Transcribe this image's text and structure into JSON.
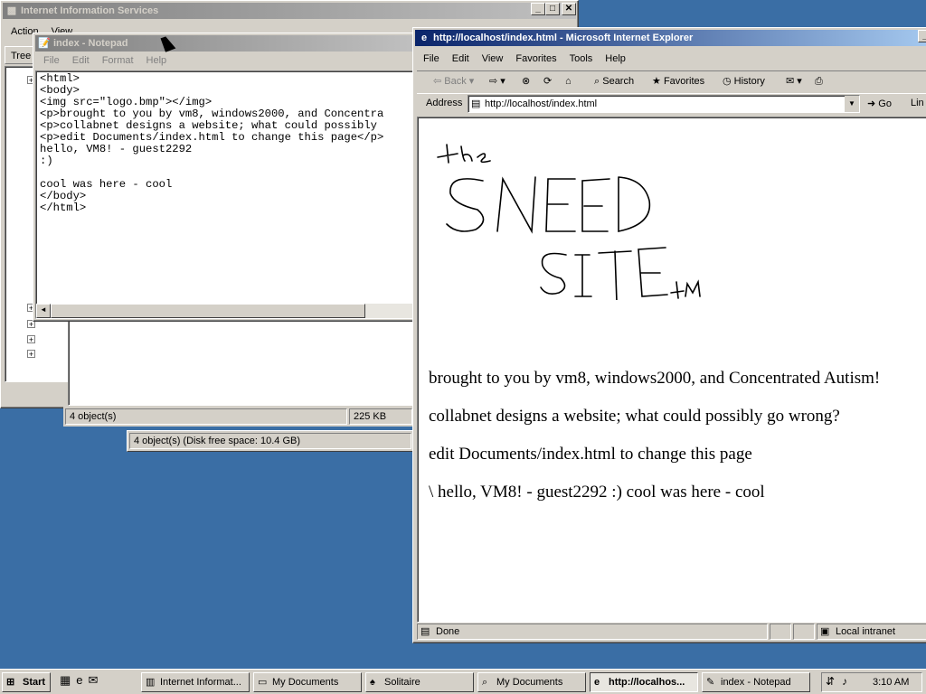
{
  "iis": {
    "title": "Internet Information Services",
    "menu": [
      "Action",
      "View"
    ],
    "tree_tab": "Tree",
    "status_count": "4 object(s)",
    "status_size": "225 KB"
  },
  "explorer_status": {
    "text": "4 object(s) (Disk free space: 10.4 GB)"
  },
  "notepad": {
    "title": "index - Notepad",
    "menu": [
      "File",
      "Edit",
      "Format",
      "Help"
    ],
    "lines": [
      "<html>",
      "<body>",
      "<img src=\"logo.bmp\"></img>",
      "<p>brought to you by vm8, windows2000, and Concentra",
      "<p>collabnet designs a website; what could possibly",
      "<p>edit Documents/index.html to change this page</p>",
      "hello, VM8! - guest2292",
      ":)",
      "",
      "cool was here - cool",
      "</body>",
      "</html>"
    ]
  },
  "ie": {
    "title": "http://localhost/index.html - Microsoft Internet Explorer",
    "menu": [
      "File",
      "Edit",
      "View",
      "Favorites",
      "Tools",
      "Help"
    ],
    "toolbar": {
      "back": "Back",
      "search": "Search",
      "favorites": "Favorites",
      "history": "History"
    },
    "address_label": "Address",
    "address_value": "http://localhost/index.html",
    "go_label": "Go",
    "links_label": "Lin",
    "logo_text": {
      "line1": "the",
      "line2": "SNEED",
      "line3": "SITE",
      "tm": "TM"
    },
    "paragraphs": [
      "brought to you by vm8, windows2000, and Concentrated Autism!",
      "collabnet designs a website; what could possibly go wrong?",
      "edit Documents/index.html to change this page",
      "\\ hello, VM8! - guest2292 :) cool was here - cool"
    ],
    "status_text": "Done",
    "zone_text": "Local intranet"
  },
  "taskbar": {
    "start": "Start",
    "buttons": [
      "Internet Informat...",
      "My Documents",
      "Solitaire",
      "My Documents",
      "http://localhos...",
      "index - Notepad"
    ],
    "clock": "3:10 AM"
  },
  "colors": {
    "desktop": "#3a6ea5",
    "active_title": "#0a246a",
    "inactive_title": "#808080"
  }
}
